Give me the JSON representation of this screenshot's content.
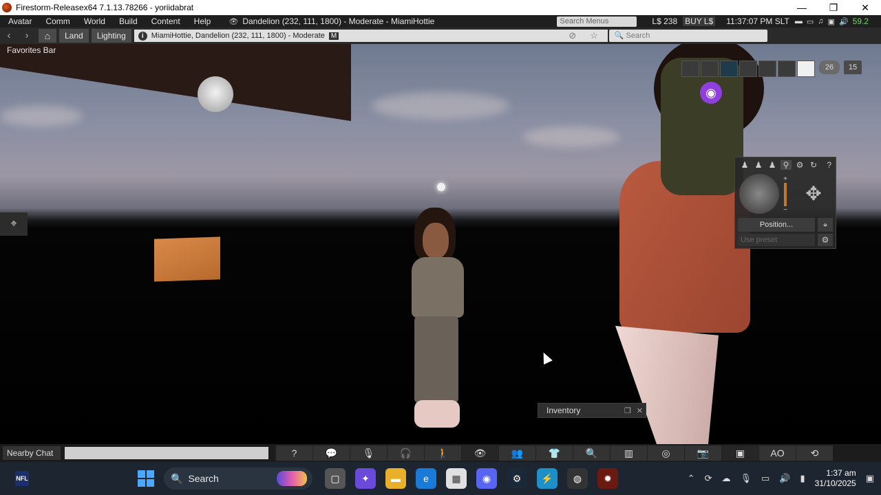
{
  "titlebar": {
    "title": "Firestorm-Releasex64 7.1.13.78266 - yoriidabrat",
    "minimize": "—",
    "maximize": "❐",
    "close": "✕"
  },
  "menubar": {
    "menus": [
      "Avatar",
      "Comm",
      "World",
      "Build",
      "Content",
      "Help"
    ],
    "location": "Dandelion (232, 111, 1800) - Moderate - MiamiHottie",
    "search_menus": "Search Menus",
    "balance": "L$ 238",
    "buy": "BUY L$",
    "time": "11:37:07 PM SLT",
    "fps": "59.2"
  },
  "navbar": {
    "land": "Land",
    "lighting": "Lighting",
    "location_text": "MiamiHottie, Dandelion (232, 111, 1800) - Moderate",
    "maturity_badge": "M",
    "search_placeholder": "Search"
  },
  "scene": {
    "favorites_bar": "Favorites Bar"
  },
  "hud": {
    "count_a": "26",
    "count_b": "15"
  },
  "camera": {
    "help": "?",
    "position_button": "Position...",
    "preset_placeholder": "Use preset"
  },
  "inventory": {
    "title": "Inventory"
  },
  "bottombar": {
    "nearby_chat": "Nearby Chat",
    "ao_label": "AO"
  },
  "taskbar": {
    "search": "Search",
    "clock_time": "1:37 am",
    "clock_date": "31/10/2025",
    "nfl_badge": "NFL"
  },
  "colors": {
    "menubar_bg": "#1f1f1f",
    "fps_green": "#7bd36b",
    "camera_zoom_accent": "#c07a2a",
    "lock_purple": "#8f3ee0",
    "windows_blue": "#4aa8ff"
  }
}
